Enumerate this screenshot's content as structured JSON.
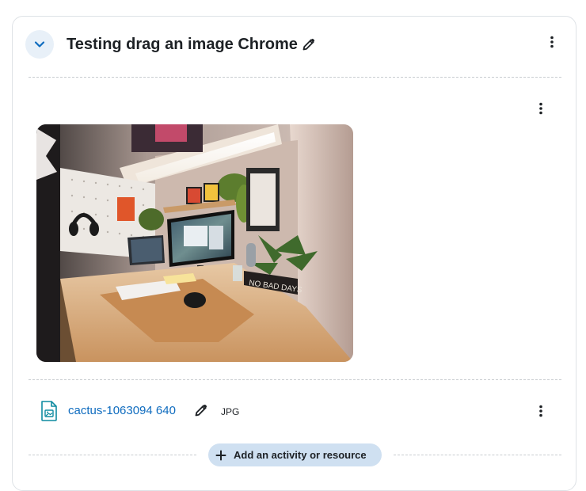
{
  "section": {
    "title": "Testing drag an image Chrome",
    "collapse_icon": "chevron-down-icon",
    "edit_icon": "pencil-icon",
    "menu_icon": "kebab-menu-icon"
  },
  "label_block": {
    "menu_icon": "kebab-menu-icon",
    "image_description": "desk setup photo"
  },
  "resource": {
    "name": "cactus-1063094 640",
    "type": "JPG",
    "file_icon": "image-file-icon",
    "edit_icon": "pencil-icon",
    "menu_icon": "kebab-menu-icon"
  },
  "add_button": {
    "label": "Add an activity or resource",
    "icon": "plus-icon"
  },
  "colors": {
    "link": "#0f6cbf",
    "button_bg": "#cfe0f1",
    "collapse_bg": "#e8f0f8",
    "text": "#1d2125",
    "divider": "#c8ccd0"
  }
}
